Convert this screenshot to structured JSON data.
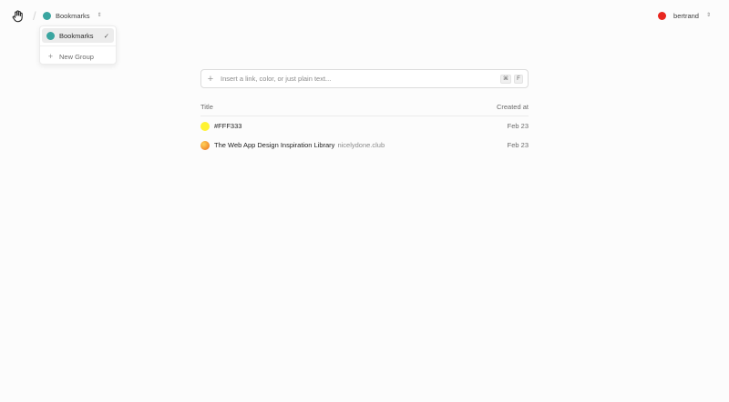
{
  "header": {
    "separator": "/",
    "group": {
      "name": "Bookmarks",
      "color": "#3aa5a0",
      "chevron": "⇕"
    },
    "user": {
      "name": "bertrand",
      "color": "#e8261f",
      "chevron": "⇕"
    }
  },
  "dropdown": {
    "items": [
      {
        "label": "Bookmarks",
        "color": "#3aa5a0",
        "selected": true,
        "check": "✓"
      }
    ],
    "new_group": {
      "label": "New Group",
      "icon": "+"
    }
  },
  "input": {
    "icon": "+",
    "placeholder": "Insert a link, color, or just plain text...",
    "value": "",
    "shortcut": [
      "⌘",
      "F"
    ]
  },
  "table": {
    "columns": {
      "title": "Title",
      "created": "Created at"
    },
    "rows": [
      {
        "title": "#FFF333",
        "domain": "",
        "date": "Feb 23",
        "icon": "color-swatch-icon",
        "color": "#fff333"
      },
      {
        "title": "The Web App Design Inspiration Library",
        "domain": "nicelydone.club",
        "date": "Feb 23",
        "icon": "favicon-icon",
        "color": "#f5a23a"
      }
    ]
  }
}
